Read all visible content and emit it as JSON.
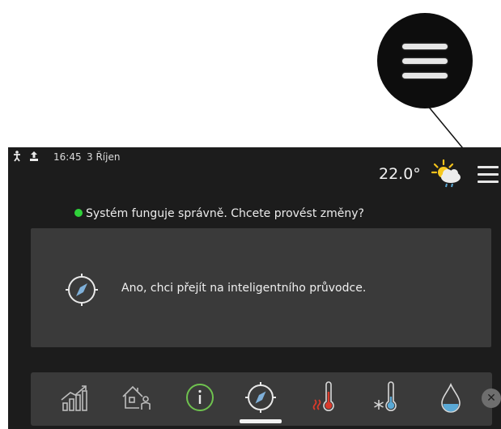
{
  "status_bar": {
    "icons": [
      "person-icon",
      "upload-icon"
    ],
    "time": "16:45",
    "date": "3  Říjen"
  },
  "header": {
    "temperature": "22.0°",
    "weather_icon": "sun-cloud-rain-icon",
    "menu_icon": "hamburger-menu-icon"
  },
  "system_message": {
    "text": "Systém funguje správně. Chcete provést změny?",
    "status_color": "#2fd13a"
  },
  "guide_card": {
    "icon": "compass-icon",
    "label": "Ano, chci přejít na inteligentního průvodce."
  },
  "bottom_nav": {
    "items": [
      {
        "icon": "bar-chart-trend-icon"
      },
      {
        "icon": "house-person-icon"
      },
      {
        "icon": "info-icon"
      },
      {
        "icon": "compass-icon",
        "active": true
      },
      {
        "icon": "thermometer-heat-icon"
      },
      {
        "icon": "thermometer-cold-icon"
      },
      {
        "icon": "water-drop-icon"
      }
    ],
    "close_icon": "close-icon",
    "close_glyph": "✕"
  },
  "colors": {
    "screen_bg": "#1c1c1c",
    "panel_bg": "#3a3a3a",
    "heat_red": "#d93a2b",
    "cold_blue": "#5aa9d6"
  }
}
